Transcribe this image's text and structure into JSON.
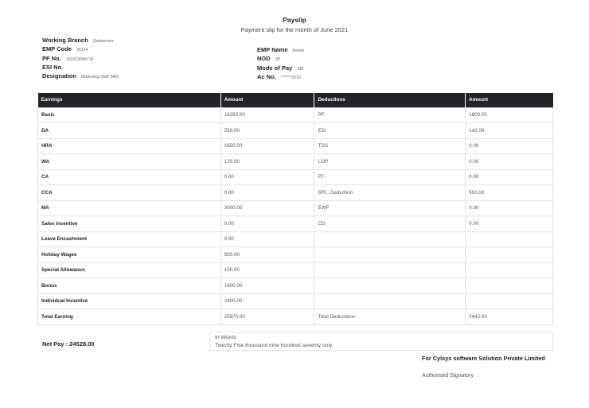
{
  "header": {
    "title": "Payslip",
    "subtitle": "Payment slip for the month of June 2021"
  },
  "employee": {
    "left": [
      {
        "label": "Working Branch",
        "value": "Gadanvara"
      },
      {
        "label": "EMP Code",
        "value": "39124"
      },
      {
        "label": "PF No.",
        "value": "10152306b714"
      },
      {
        "label": "ESI No.",
        "value": ""
      },
      {
        "label": "Designation",
        "value": "Marketing Staff (MK)"
      }
    ],
    "right": [
      {
        "label": "EMP Name",
        "value": "Ashok"
      },
      {
        "label": "NOD",
        "value": "28"
      },
      {
        "label": "Mode of Pay",
        "value": "SBI"
      },
      {
        "label": "Ac No.",
        "value": "*******0701"
      }
    ]
  },
  "table": {
    "headers": [
      "Earnings",
      "Amount",
      "Deductions",
      "Amount"
    ],
    "rows": [
      {
        "earning": "Basic",
        "earning_amount": "16250.00",
        "deduction": "PF",
        "deduction_amount": "1800.00"
      },
      {
        "earning": "DA",
        "earning_amount": "550.00",
        "deduction": "ESI",
        "deduction_amount": "142.00"
      },
      {
        "earning": "HRA",
        "earning_amount": "1650.00",
        "deduction": "TDS",
        "deduction_amount": "0.00"
      },
      {
        "earning": "WA",
        "earning_amount": "120.00",
        "deduction": "LOP",
        "deduction_amount": "0.00"
      },
      {
        "earning": "CA",
        "earning_amount": "0.00",
        "deduction": "PT",
        "deduction_amount": "0.00"
      },
      {
        "earning": "CCA",
        "earning_amount": "0.00",
        "deduction": "SPL. Deduction",
        "deduction_amount": "500.00"
      },
      {
        "earning": "MA",
        "earning_amount": "3000.00",
        "deduction": "EWF",
        "deduction_amount": "0.00"
      },
      {
        "earning": "Sales Incentive",
        "earning_amount": "0.00",
        "deduction": "CD",
        "deduction_amount": "0.00"
      },
      {
        "earning": "Leave Encashment",
        "earning_amount": "0.00",
        "deduction": "",
        "deduction_amount": ""
      },
      {
        "earning": "Holiday Wages",
        "earning_amount": "500.00",
        "deduction": "",
        "deduction_amount": ""
      },
      {
        "earning": "Special Allowance",
        "earning_amount": "100.00",
        "deduction": "",
        "deduction_amount": ""
      },
      {
        "earning": "Bonus",
        "earning_amount": "1400.00",
        "deduction": "",
        "deduction_amount": ""
      },
      {
        "earning": "Individual Incentive",
        "earning_amount": "2400.00",
        "deduction": "",
        "deduction_amount": ""
      }
    ],
    "total": {
      "earning": "Total Earning",
      "earning_amount": "25970.00",
      "deduction": "Total Deductions",
      "deduction_amount": "2442.00"
    }
  },
  "footer": {
    "net_pay": "Net Pay : 24528.00",
    "in_words_label": "In Words",
    "in_words_value": "Twenty Five thousand nine hundred seventy only",
    "company": "For Cylsys software Solution Private Limited",
    "signatory": "Authorised Signatory"
  }
}
